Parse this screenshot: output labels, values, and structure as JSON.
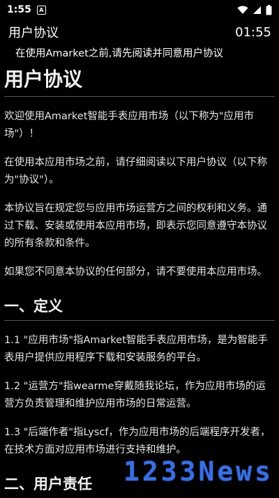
{
  "status_bar": {
    "time": "1:55",
    "notification_icon": "A"
  },
  "app_bar": {
    "title": "用户协议",
    "clock": "01:55"
  },
  "notice": "在使用Amarket之前,请先阅读并同意用户协议",
  "document": {
    "title": "用户协议",
    "intro": [
      "欢迎使用Amarket智能手表应用市场（以下称为\"应用市场\"）！",
      "在使用本应用市场之前，请仔细阅读以下用户协议（以下称为\"协议\"）。",
      "本协议旨在规定您与应用市场运营方之间的权利和义务。通过下载、安装或使用本应用市场，即表示您同意遵守本协议的所有条款和条件。",
      "如果您不同意本协议的任何部分，请不要使用本应用市场。"
    ],
    "section1": {
      "heading": "一、定义",
      "items": [
        "1.1 \"应用市场\"指Amarket智能手表应用市场，是为智能手表用户提供应用程序下载和安装服务的平台。",
        "1.2 \"运营方\"指wearme穿戴随我论坛，作为应用市场的运营方负责管理和维护应用市场的日常运营。",
        "1.3 \"后端作者\"指Lyscf，作为应用市场的后端程序开发者，在技术方面对应用市场进行支持和维护。"
      ]
    },
    "section2": {
      "heading": "二、用户责任"
    }
  },
  "watermark": "1233News"
}
